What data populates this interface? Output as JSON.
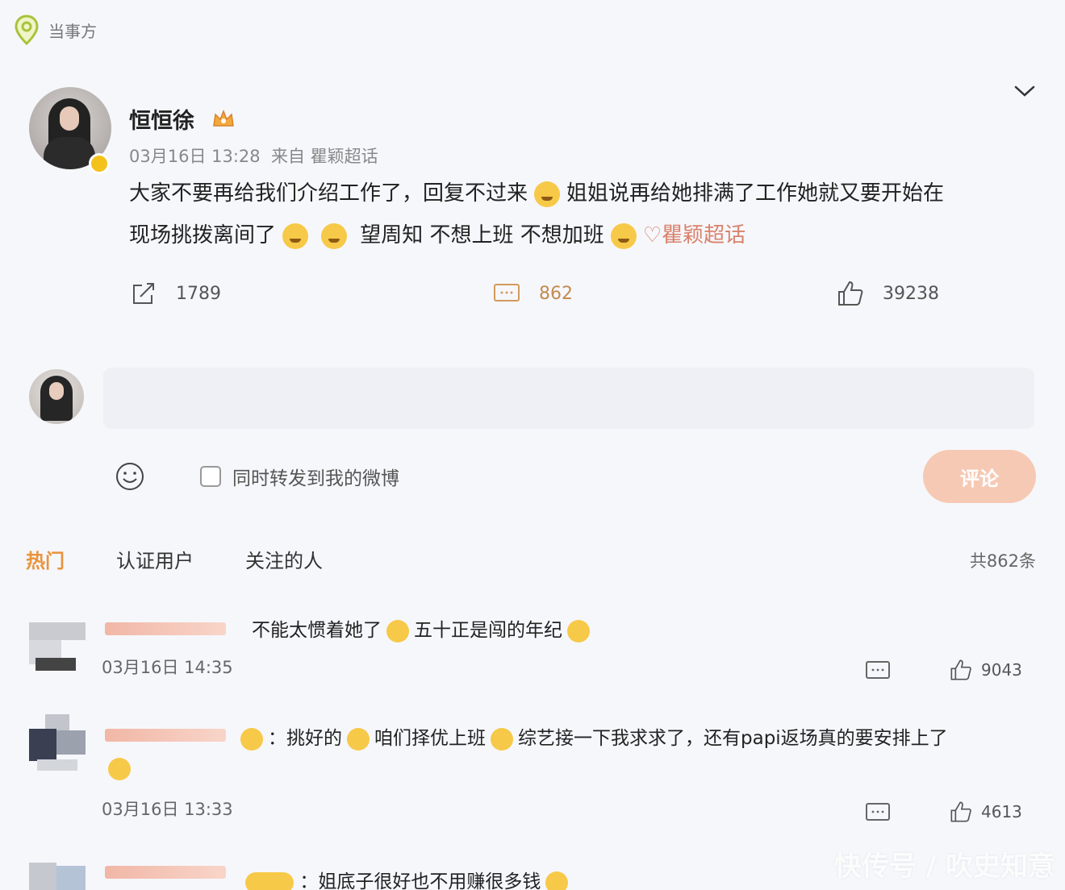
{
  "topbar": {
    "source_label": "当事方"
  },
  "post": {
    "author": "恒恒徐",
    "time": "03月16日 13:28",
    "source": "来自 瞿颖超话",
    "text_part1": "大家不要再给我们介绍工作了，回复不过来",
    "text_part2": "姐姐说再给她排满了工作她就又要开始在",
    "text_part3": "现场挑拨离间了",
    "text_part4": "望周知 不想上班 不想加班",
    "topic": "瞿颖超话",
    "stats": {
      "forward": "1789",
      "comments": "862",
      "likes": "39238"
    }
  },
  "composer": {
    "forward_label": "同时转发到我的微博",
    "submit_label": "评论"
  },
  "tabs": {
    "hot": "热门",
    "verified": "认证用户",
    "following": "关注的人",
    "total": "共862条"
  },
  "comments": [
    {
      "text_a": "不能太惯着她了",
      "text_b": "五十正是闯的年纪",
      "date": "03月16日 14:35",
      "likes": "9043"
    },
    {
      "text_a": "：挑好的",
      "text_b": "咱们择优上班",
      "text_c": "综艺接一下我求求了，还有papi返场真的要安排上了",
      "date": "03月16日 13:33",
      "likes": "4613"
    },
    {
      "text_a": "：姐底子很好也不用赚很多钱"
    }
  ],
  "watermark": "快传号 / 吹史知意",
  "colors": {
    "accent": "#e8943d",
    "topic": "#d9826b",
    "submit": "#f6c9b4"
  }
}
